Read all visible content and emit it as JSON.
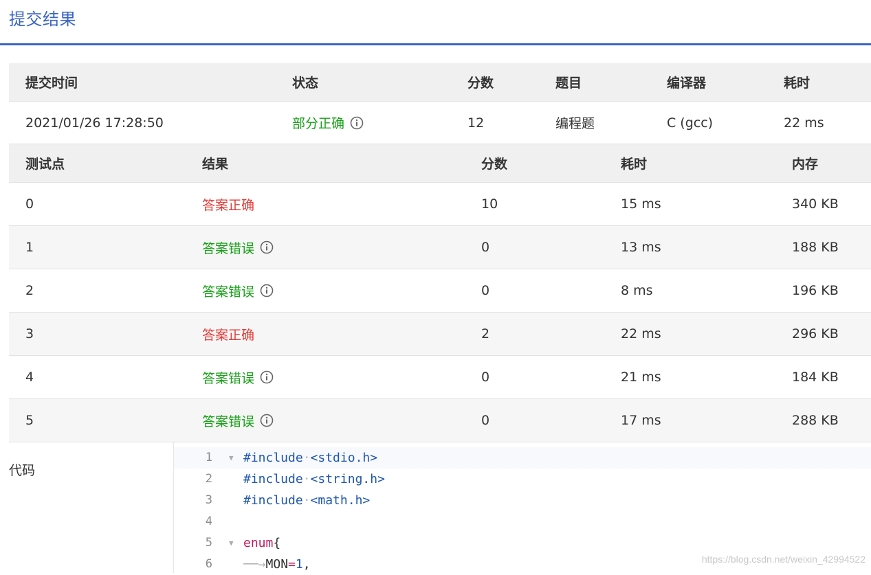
{
  "page_title": "提交结果",
  "summary": {
    "headers": [
      "提交时间",
      "状态",
      "分数",
      "题目",
      "编译器",
      "耗时"
    ],
    "row": {
      "time": "2021/01/26 17:28:50",
      "status": "部分正确",
      "score": "12",
      "problem": "编程题",
      "compiler": "C (gcc)",
      "elapsed": "22 ms"
    }
  },
  "cases": {
    "headers": [
      "测试点",
      "结果",
      "分数",
      "耗时",
      "内存"
    ],
    "rows": [
      {
        "id": "0",
        "result": "答案正确",
        "score": "10",
        "time": "15 ms",
        "memory": "340 KB"
      },
      {
        "id": "1",
        "result": "答案错误",
        "score": "0",
        "time": "13 ms",
        "memory": "188 KB"
      },
      {
        "id": "2",
        "result": "答案错误",
        "score": "0",
        "time": "8 ms",
        "memory": "196 KB"
      },
      {
        "id": "3",
        "result": "答案正确",
        "score": "2",
        "time": "22 ms",
        "memory": "296 KB"
      },
      {
        "id": "4",
        "result": "答案错误",
        "score": "0",
        "time": "21 ms",
        "memory": "184 KB"
      },
      {
        "id": "5",
        "result": "答案错误",
        "score": "0",
        "time": "17 ms",
        "memory": "288 KB"
      }
    ]
  },
  "code": {
    "label": "代码",
    "lines": [
      {
        "n": "1",
        "kw": "#include",
        "rest": "<stdio.h>"
      },
      {
        "n": "2",
        "kw": "#include",
        "rest": "<string.h>"
      },
      {
        "n": "3",
        "kw": "#include",
        "rest": "<math.h>"
      },
      {
        "n": "4"
      },
      {
        "n": "5",
        "kw": "enum",
        "rest": "{"
      },
      {
        "n": "6",
        "name": "MON",
        "op": "=",
        "num": "1",
        "tail": ","
      }
    ]
  },
  "watermark": "https://blog.csdn.net/weixin_42994522",
  "colors": {
    "accent": "#3a64c4",
    "correct": "#e53935",
    "wrong": "#18a018"
  }
}
